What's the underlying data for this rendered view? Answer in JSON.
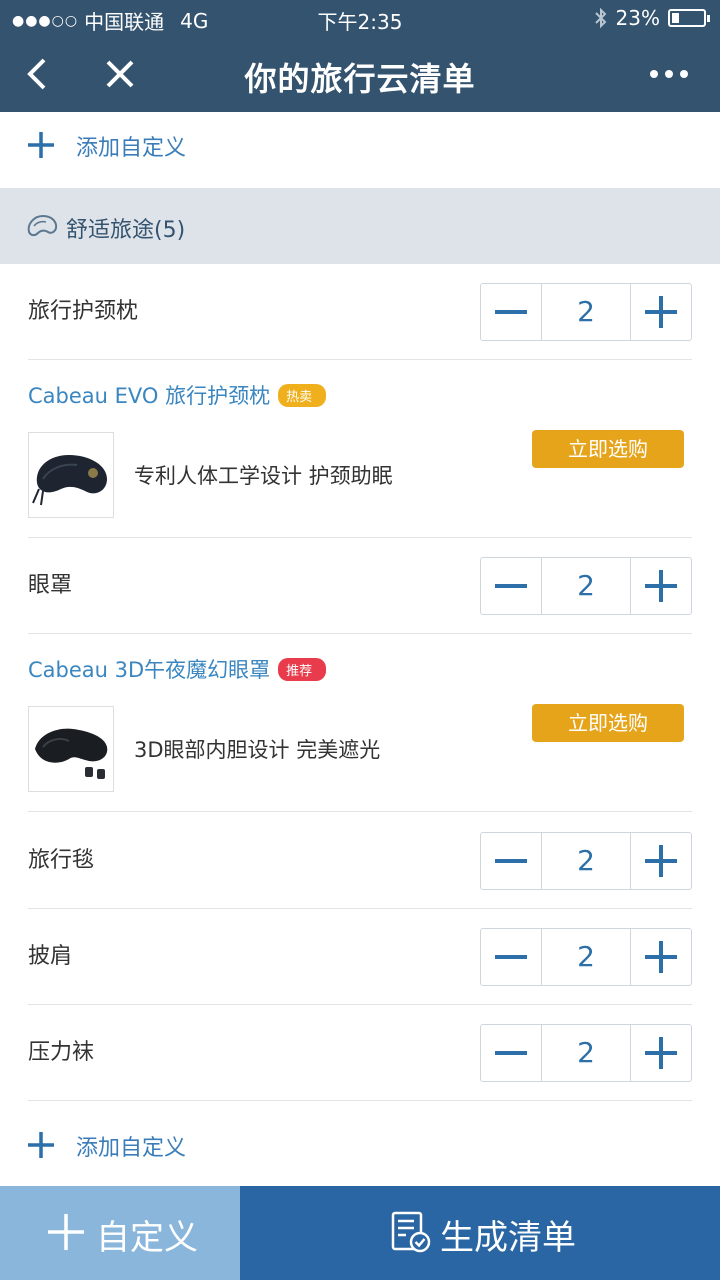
{
  "status_bar": {
    "carrier": "中国联通",
    "network": "4G",
    "time": "下午2:35",
    "battery_text": "23%",
    "battery_level": 0.23
  },
  "nav": {
    "title": "你的旅行云清单"
  },
  "add_custom_top": {
    "label": "添加自定义"
  },
  "section": {
    "label": "舒适旅途(5)"
  },
  "items": [
    {
      "name": "旅行护颈枕",
      "qty": "2"
    },
    {
      "name": "眼罩",
      "qty": "2"
    },
    {
      "name": "旅行毯",
      "qty": "2"
    },
    {
      "name": "披肩",
      "qty": "2"
    },
    {
      "name": "压力袜",
      "qty": "2"
    }
  ],
  "products": [
    {
      "title": "Cabeau EVO 旅行护颈枕",
      "badge": "热卖",
      "desc": "专利人体工学设计 护颈助眠",
      "buy_label": "立即选购"
    },
    {
      "title": "Cabeau 3D午夜魔幻眼罩",
      "badge": "推荐",
      "desc": "3D眼部内胆设计 完美遮光",
      "buy_label": "立即选购"
    }
  ],
  "add_custom_bottom": {
    "label": "添加自定义"
  },
  "bottom_bar": {
    "custom_label": "自定义",
    "generate_label": "生成清单"
  },
  "colors": {
    "nav_bg": "#34536f",
    "accent": "#2d6fa8",
    "buy_button": "#e6a41b",
    "hot_badge": "#f0b01e",
    "rec_badge": "#e83b4b"
  }
}
